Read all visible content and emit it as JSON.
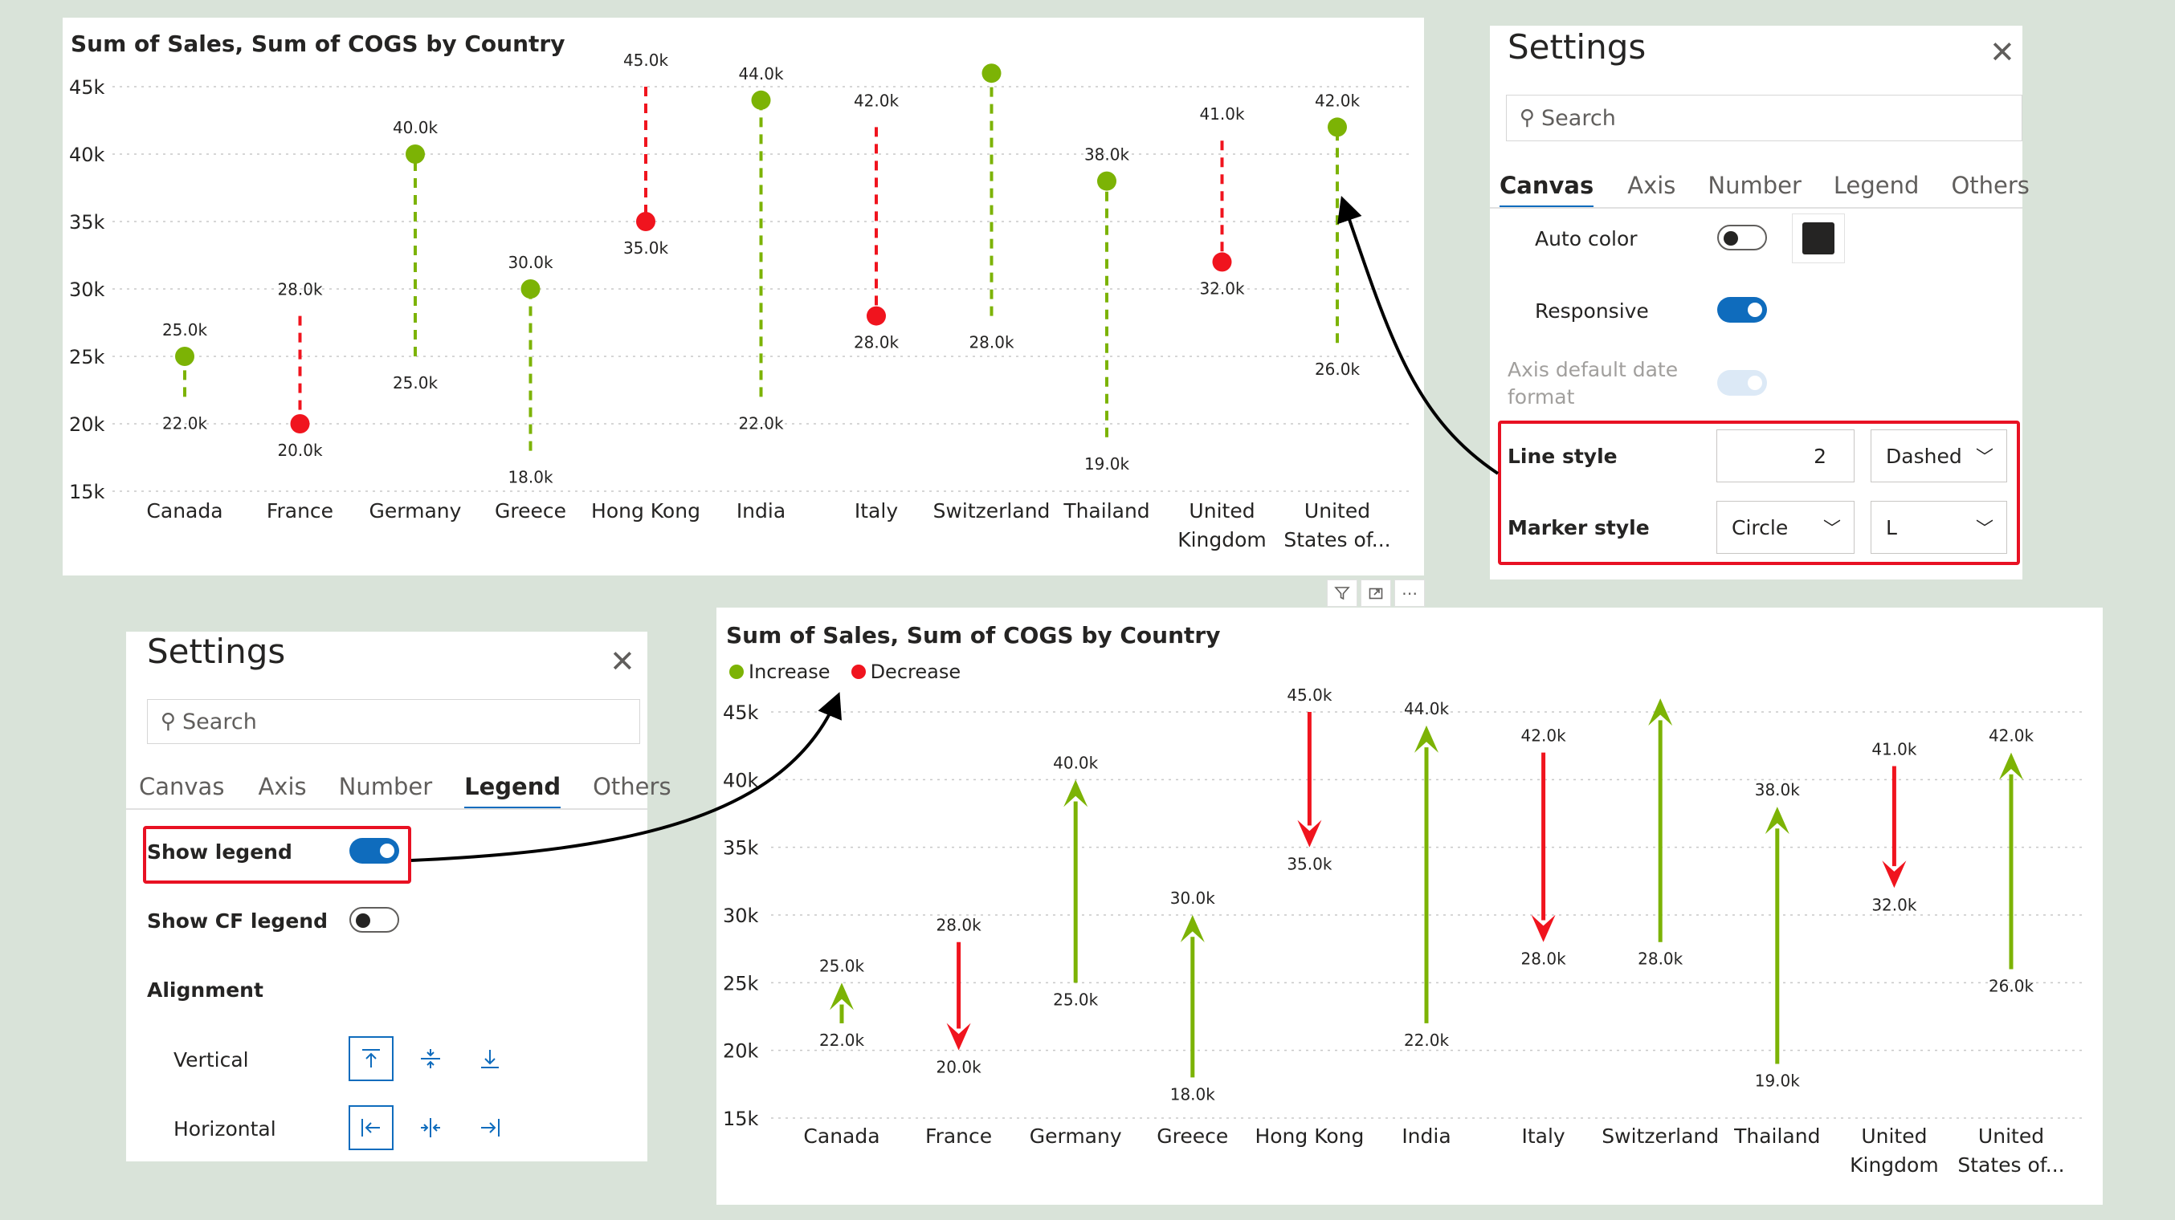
{
  "colors": {
    "increase": "#7cb305",
    "decrease": "#f0141e",
    "accent": "#0f6cbd",
    "highlight": "#e81123",
    "background": "#d9e3d9",
    "swatch": "#252423"
  },
  "chart_data": [
    {
      "type": "dot-dumbbell",
      "title": "Sum of Sales, Sum of COGS by Country",
      "line_style": "dashed",
      "marker_style": "circle",
      "y_ticks": [
        "45k",
        "40k",
        "35k",
        "30k",
        "25k",
        "20k",
        "15k"
      ],
      "ylim": [
        15000,
        45000
      ],
      "grid": true,
      "categories": [
        [
          "Canada"
        ],
        [
          "France"
        ],
        [
          "Germany"
        ],
        [
          "Greece"
        ],
        [
          "Hong Kong"
        ],
        [
          "India"
        ],
        [
          "Italy"
        ],
        [
          "Switzerland"
        ],
        [
          "Thailand"
        ],
        [
          "United",
          "Kingdom"
        ],
        [
          "United",
          "States of..."
        ]
      ],
      "series": [
        {
          "name": "Sales",
          "values": [
            25000,
            20000,
            40000,
            30000,
            35000,
            44000,
            28000,
            46000,
            38000,
            32000,
            42000
          ]
        },
        {
          "name": "COGS",
          "values": [
            22000,
            28000,
            25000,
            18000,
            45000,
            22000,
            42000,
            28000,
            19000,
            41000,
            26000
          ]
        }
      ],
      "data_labels": [
        [
          "25.0k",
          "22.0k"
        ],
        [
          "20.0k",
          "28.0k"
        ],
        [
          "40.0k",
          "25.0k"
        ],
        [
          "30.0k",
          "18.0k"
        ],
        [
          "35.0k",
          "45.0k"
        ],
        [
          "44.0k",
          "22.0k"
        ],
        [
          "28.0k",
          "42.0k"
        ],
        [
          "",
          "28.0k"
        ],
        [
          "38.0k",
          "19.0k"
        ],
        [
          "32.0k",
          "41.0k"
        ],
        [
          "42.0k",
          "26.0k"
        ]
      ]
    },
    {
      "type": "arrow",
      "title": "Sum of Sales, Sum of COGS by Country",
      "legend": {
        "position": "top-left",
        "items": [
          "Increase",
          "Decrease"
        ]
      },
      "y_ticks": [
        "45k",
        "40k",
        "35k",
        "30k",
        "25k",
        "20k",
        "15k"
      ],
      "ylim": [
        15000,
        45000
      ],
      "grid": true,
      "categories": [
        [
          "Canada"
        ],
        [
          "France"
        ],
        [
          "Germany"
        ],
        [
          "Greece"
        ],
        [
          "Hong Kong"
        ],
        [
          "India"
        ],
        [
          "Italy"
        ],
        [
          "Switzerland"
        ],
        [
          "Thailand"
        ],
        [
          "United",
          "Kingdom"
        ],
        [
          "United",
          "States of..."
        ]
      ],
      "series": [
        {
          "name": "Sales",
          "values": [
            25000,
            20000,
            40000,
            30000,
            35000,
            44000,
            28000,
            46000,
            38000,
            32000,
            42000
          ]
        },
        {
          "name": "COGS",
          "values": [
            22000,
            28000,
            25000,
            18000,
            45000,
            22000,
            42000,
            28000,
            19000,
            41000,
            26000
          ]
        }
      ],
      "data_labels": [
        [
          "25.0k",
          "22.0k"
        ],
        [
          "20.0k",
          "28.0k"
        ],
        [
          "40.0k",
          "25.0k"
        ],
        [
          "30.0k",
          "18.0k"
        ],
        [
          "35.0k",
          "45.0k"
        ],
        [
          "44.0k",
          "22.0k"
        ],
        [
          "28.0k",
          "42.0k"
        ],
        [
          "",
          "28.0k"
        ],
        [
          "38.0k",
          "19.0k"
        ],
        [
          "32.0k",
          "41.0k"
        ],
        [
          "42.0k",
          "26.0k"
        ]
      ]
    }
  ],
  "settings_top": {
    "title": "Settings",
    "close_icon": "close-icon",
    "search_placeholder": "Search",
    "tabs": [
      "Canvas",
      "Axis",
      "Number",
      "Legend",
      "Others"
    ],
    "active_tab": "Canvas",
    "auto_color_label": "Auto color",
    "auto_color_on": false,
    "responsive_label": "Responsive",
    "responsive_on": true,
    "axis_date_label": "Axis default date format",
    "line_style_label": "Line style",
    "line_width": "2",
    "line_type": "Dashed",
    "marker_style_label": "Marker style",
    "marker_shape": "Circle",
    "marker_size": "L"
  },
  "settings_bottom": {
    "title": "Settings",
    "search_placeholder": "Search",
    "tabs": [
      "Canvas",
      "Axis",
      "Number",
      "Legend",
      "Others"
    ],
    "active_tab": "Legend",
    "show_legend_label": "Show legend",
    "show_legend_on": true,
    "show_cf_legend_label": "Show CF legend",
    "show_cf_legend_on": false,
    "alignment_label": "Alignment",
    "vertical_label": "Vertical",
    "horizontal_label": "Horizontal",
    "vertical_options": [
      "align-top-icon",
      "align-middle-icon",
      "align-bottom-icon"
    ],
    "horizontal_options": [
      "align-left-icon",
      "align-center-icon",
      "align-right-icon"
    ]
  },
  "visual_header": [
    "filter-icon",
    "focus-mode-icon",
    "more-options-icon"
  ]
}
